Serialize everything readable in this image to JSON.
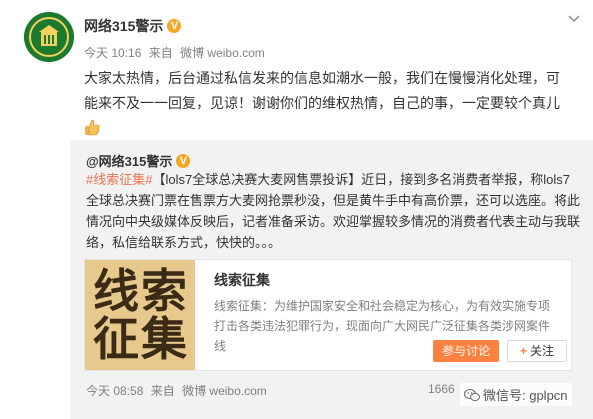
{
  "post": {
    "author": "网络315警示",
    "time": "今天 10:16",
    "source_prefix": "来自",
    "source": "微博 weibo.com",
    "text": "大家太热情，后台通过私信发来的信息如潮水一般，我们在慢慢消化处理，可能来不及一一回复，见谅！谢谢你们的维权热情，自己的事，一定要较个真儿"
  },
  "repost": {
    "author": "@网络315警示",
    "hashtag": "#线索征集#",
    "topic": "【lols7全球总决赛大麦网售票投诉】",
    "text": "近日，接到多名消费者举报，称lols7全球总决赛门票在售票方大麦网抢票秒没，但是黄牛手中有高价票，还可以选座。将此情况向中央级媒体反映后，记者准备采访。欢迎掌握较多情况的消费者代表主动与我联络，私信给联系方式，快快的。。。",
    "card": {
      "image_text": [
        "线",
        "索",
        "征",
        "集"
      ],
      "title": "线索征集",
      "desc": "线索征集：为维护国家安全和社会稳定为核心，为有效实施专项打击各类违法犯罪行为，现面向广大网民广泛征集各类涉网案件线",
      "join_label": "参与讨论",
      "follow_plus": "+",
      "follow_label": "关注"
    },
    "time": "今天 08:58",
    "source_prefix": "来自",
    "source": "微博 weibo.com",
    "count": "1666"
  },
  "watermark": "微信号: gplpcn",
  "colors": {
    "accent": "#eb7350",
    "button": "#ff8140",
    "avatar_bg": "#1c7a2e",
    "card_image_bg": "#e8c98d"
  },
  "icons": [
    "emblem-avatar-icon",
    "vip-badge-icon",
    "chevron-down-icon",
    "thumbs-up-icon",
    "plus-icon",
    "wechat-icon"
  ]
}
